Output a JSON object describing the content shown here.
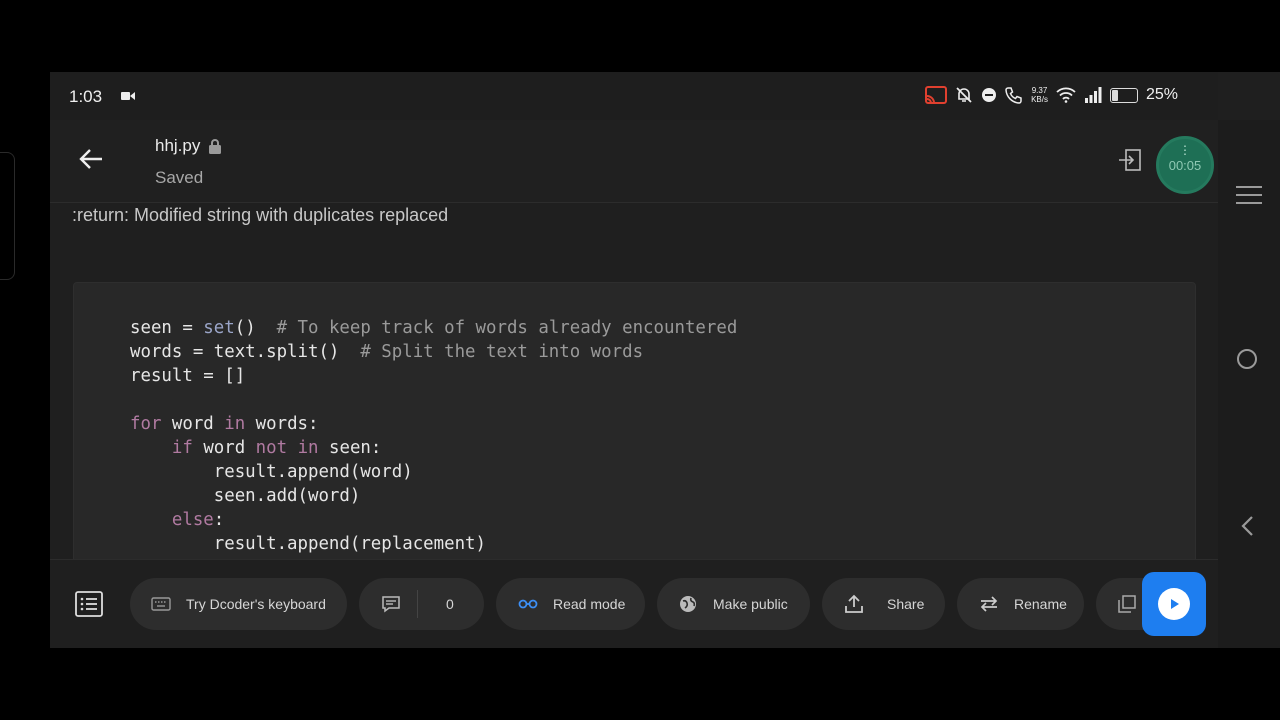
{
  "status_bar": {
    "time": "1:03",
    "net_speed_value": "9.37",
    "net_speed_unit": "KB/s",
    "battery_percent": "25%",
    "battery_level": 0.25
  },
  "header": {
    "file_name": "hhj.py",
    "save_status": "Saved",
    "timer": "00:05"
  },
  "content": {
    "doc_line": ":return: Modified string with duplicates replaced",
    "code_lines": [
      "seen = set()  # To keep track of words already encountered",
      "words = text.split()  # Split the text into words",
      "result = []",
      "",
      "for word in words:",
      "    if word not in seen:",
      "        result.append(word)",
      "        seen.add(word)",
      "    else:",
      "        result.append(replacement)"
    ]
  },
  "toolbar": {
    "keyboard_label": "Try Dcoder's keyboard",
    "comments_count": "0",
    "read_mode_label": "Read mode",
    "make_public_label": "Make public",
    "share_label": "Share",
    "rename_label": "Rename"
  },
  "colors": {
    "run_button": "#1e7ef0",
    "timer_bubble": "#1e6f55",
    "keyword": "#b07aa1",
    "builtin": "#9aa5c8",
    "comment": "#9a9a9a"
  }
}
